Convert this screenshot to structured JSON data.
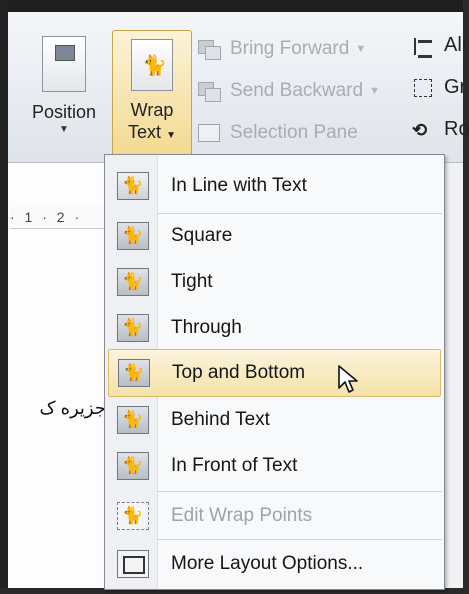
{
  "ribbon": {
    "position": {
      "label": "Position",
      "icon": "position-icon"
    },
    "wrap_text": {
      "label_line1": "Wrap",
      "label_line2": "Text",
      "icon": "wrap-text-icon"
    },
    "bring_forward": {
      "label": "Bring Forward",
      "icon": "bring-forward-icon"
    },
    "send_backward": {
      "label": "Send Backward",
      "icon": "send-backward-icon"
    },
    "selection_pane": {
      "label": "Selection Pane",
      "icon": "selection-pane-icon"
    },
    "align": {
      "label": "Ali",
      "icon": "align-icon"
    },
    "group": {
      "label": "Gr",
      "icon": "group-icon"
    },
    "rotate": {
      "label": "Ro",
      "icon": "rotate-icon"
    }
  },
  "ruler": {
    "text": "· 1 · 2 ·"
  },
  "document": {
    "rtl_text": "جزیره ک"
  },
  "wrap_menu": {
    "items": [
      {
        "label": "In Line with Text",
        "icon": "inline-with-text-icon"
      },
      {
        "label": "Square",
        "icon": "square-wrap-icon"
      },
      {
        "label": "Tight",
        "icon": "tight-wrap-icon"
      },
      {
        "label": "Through",
        "icon": "through-wrap-icon"
      },
      {
        "label": "Top and Bottom",
        "icon": "top-bottom-wrap-icon",
        "highlighted": true
      },
      {
        "label": "Behind Text",
        "icon": "behind-text-icon"
      },
      {
        "label": "In Front of Text",
        "icon": "in-front-of-text-icon"
      },
      {
        "label": "Edit Wrap Points",
        "icon": "edit-wrap-points-icon",
        "disabled": true
      },
      {
        "label": "More Layout Options...",
        "icon": "layout-options-icon"
      }
    ]
  }
}
